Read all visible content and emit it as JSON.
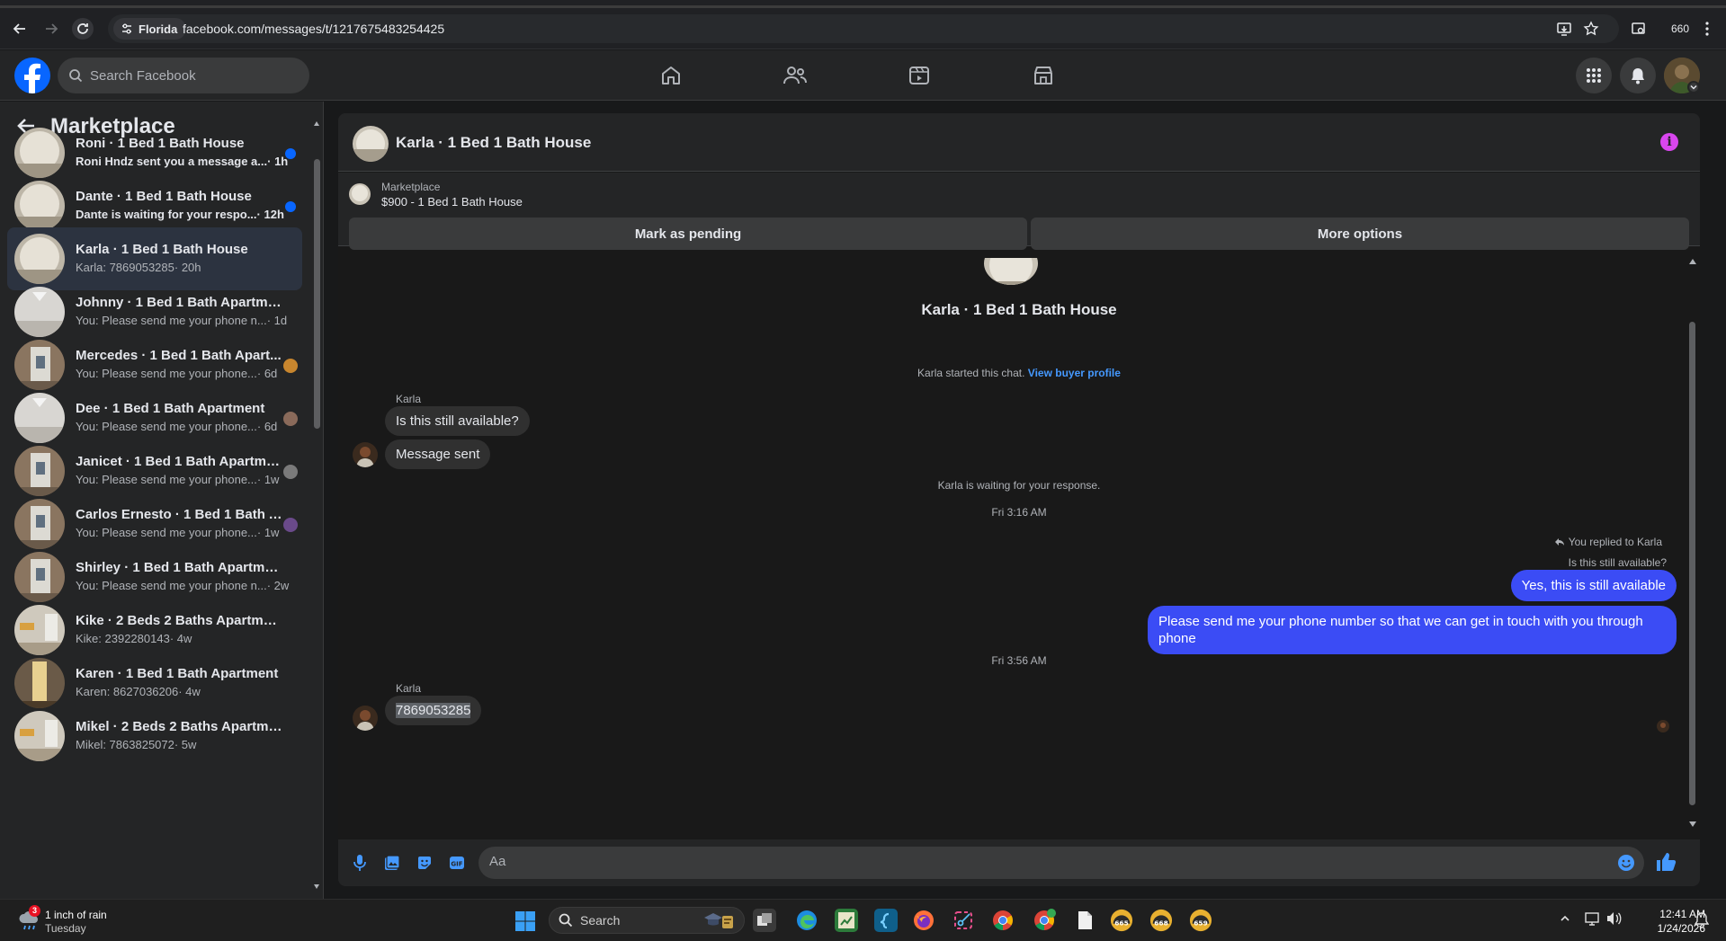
{
  "browser": {
    "site_chip": "Florida",
    "url": "facebook.com/messages/t/1217675483254425",
    "zoom_readout": "660"
  },
  "fb": {
    "search_placeholder": "Search Facebook"
  },
  "sidebar": {
    "title": "Marketplace",
    "conversations": [
      {
        "title": "Roni · 1 Bed 1 Bath House",
        "snippet": "Roni Hndz sent you a message a...",
        "time": " · 1h",
        "unread": true,
        "thumb": "house"
      },
      {
        "title": "Dante · 1 Bed 1 Bath House",
        "snippet": "Dante is waiting for your respo...",
        "time": " · 12h",
        "unread": true,
        "thumb": "house"
      },
      {
        "title": "Karla · 1 Bed 1 Bath House",
        "snippet": "Karla: 7869053285",
        "time": " · 20h",
        "unread": false,
        "thumb": "house"
      },
      {
        "title": "Johnny · 1 Bed 1 Bath Apartment",
        "snippet": "You: Please send me your phone n...",
        "time": " · 1d",
        "unread": false,
        "thumb": "room"
      },
      {
        "title": "Mercedes · 1 Bed 1 Bath Apart...",
        "snippet": "You: Please send me your phone...",
        "time": " · 6d",
        "unread": false,
        "thumb": "door"
      },
      {
        "title": "Dee · 1 Bed 1 Bath Apartment",
        "snippet": "You: Please send me your phone...",
        "time": " · 6d",
        "unread": false,
        "thumb": "room"
      },
      {
        "title": "Janicet · 1 Bed 1 Bath Apartme...",
        "snippet": "You: Please send me your phone...",
        "time": " · 1w",
        "unread": false,
        "thumb": "door"
      },
      {
        "title": "Carlos Ernesto · 1 Bed 1 Bath A...",
        "snippet": "You: Please send me your phone...",
        "time": " · 1w",
        "unread": false,
        "thumb": "door"
      },
      {
        "title": "Shirley · 1 Bed 1 Bath Apartment",
        "snippet": "You: Please send me your phone n...",
        "time": " · 2w",
        "unread": false,
        "thumb": "door"
      },
      {
        "title": "Kike · 2 Beds 2 Baths Apartment",
        "snippet": "Kike: 2392280143",
        "time": " · 4w",
        "unread": false,
        "thumb": "apt"
      },
      {
        "title": "Karen · 1 Bed 1 Bath Apartment",
        "snippet": "Karen: 8627036206",
        "time": " · 4w",
        "unread": false,
        "thumb": "hall"
      },
      {
        "title": "Mikel · 2 Beds 2 Baths Apartment",
        "snippet": "Mikel: 7863825072",
        "time": " · 5w",
        "unread": false,
        "thumb": "apt"
      }
    ]
  },
  "chat": {
    "header_title": "Karla · 1 Bed 1 Bath House",
    "listing_label": "Marketplace",
    "listing_title": "$900 - 1 Bed 1 Bath House",
    "mark_pending_label": "Mark as pending",
    "more_options_label": "More options",
    "intro_title": "Karla · 1 Bed 1 Bath House",
    "started_text": "Karla started this chat.",
    "view_profile_link": "View buyer profile",
    "sender_name": "Karla",
    "msg_1": "Is this still available?",
    "msg_2": "Message sent",
    "waiting_text": "Karla is waiting for your response.",
    "timestamp_1": "Fri 3:16 AM",
    "replied_to": "You replied to Karla",
    "quoted": "Is this still available?",
    "out_1": "Yes, this is still available",
    "out_2": "Please send me your phone  number so that we can get in touch with you through phone",
    "timestamp_2": "Fri 3:56 AM",
    "sender_name_2": "Karla",
    "msg_3": "7869053285",
    "input_placeholder": "Aa"
  },
  "taskbar": {
    "weather_title": "1 inch of rain",
    "weather_sub": "Tuesday",
    "weather_badge": "3",
    "search_label": "Search",
    "clock_time": "12:41 AM",
    "clock_date": "1/24/2026",
    "app_labels": [
      "665",
      "668",
      "659"
    ]
  },
  "colors": {
    "accent": "#0866ff",
    "outgoing_bubble": "#3b4cf5",
    "info_icon": "#d946ef"
  }
}
